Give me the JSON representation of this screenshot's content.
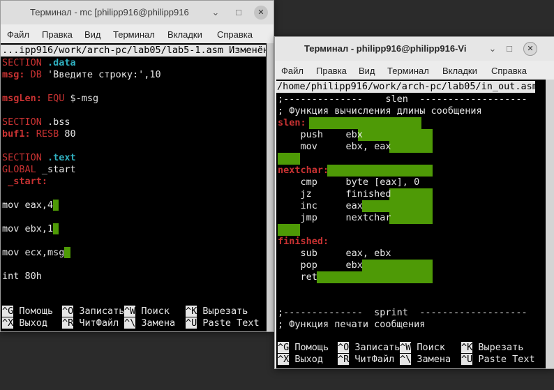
{
  "win1": {
    "title": "Терминал - mc [philipp916@philipp916",
    "minimize": "⌄",
    "maximize": "□",
    "close": "✕",
    "menu": [
      "Файл",
      "Правка",
      "Вид",
      "Терминал",
      "Вкладки",
      "Справка"
    ],
    "header": "...ipp916/work/arch-pc/lab05/lab5-1.asm Изменён",
    "code": {
      "sec_data_kw": "SECTION",
      "sec_data_name": " .data",
      "msg_label": "msg:",
      "msg_db": " DB",
      "msg_str": " 'Введите строку:',10",
      "msglen_label": "msgLen:",
      "msglen_equ": " EQU",
      "msglen_val": " $-msg",
      "sec_bss_kw": "SECTION",
      "sec_bss_name": " .bss",
      "buf_label": "buf1:",
      "buf_resb": " RESB",
      "buf_val": " 80",
      "sec_text_kw": "SECTION",
      "sec_text_name": " .text",
      "global_kw": "GLOBAL",
      "global_val": " _start",
      "start_label": " _start:",
      "l_mov_eax": "mov eax,4",
      "l_mov_ebx": "mov ebx,1",
      "l_mov_ecx": "mov ecx,msg",
      "l_int": "int 80h"
    },
    "shortcuts": {
      "k1": "^G",
      "l1": " Помощь",
      "k2": "^O",
      "l2": " Записать",
      "k3": "^W",
      "l3": " Поиск",
      "k4": "^K",
      "l4": " Вырезать",
      "k5": "^X",
      "l5": " Выход",
      "k6": "^R",
      "l6": " ЧитФайл",
      "k7": "^\\",
      "l7": " Замена",
      "k8": "^U",
      "l8": " Paste Text"
    }
  },
  "win2": {
    "title": "Терминал - philipp916@philipp916-Vi",
    "minimize": "⌄",
    "maximize": "□",
    "close": "✕",
    "menu": [
      "Файл",
      "Правка",
      "Вид",
      "Терминал",
      "Вкладки",
      "Справка"
    ],
    "header": "/home/philipp916/work/arch-pc/lab05/in_out.asm",
    "code": {
      "sep1": ";--------------    slen  -------------------",
      "c1": "; Функция вычисления длины сообщения",
      "slen_label": "slen:",
      "push": "    push    ebx",
      "mov": "    mov     ebx, eax",
      "nextchar_label": "nextchar:",
      "cmp": "    cmp     byte [eax], 0",
      "jz": "    jz      finished",
      "inc": "    inc     eax",
      "jmp": "    jmp     nextchar",
      "finished_label": "finished:",
      "sub": "    sub     eax, ebx",
      "pop": "    pop     ebx",
      "ret": "    ret",
      "sep2": ";--------------  sprint  -------------------",
      "c2": "; Функция печати сообщения"
    },
    "shortcuts": {
      "k1": "^G",
      "l1": " Помощь",
      "k2": "^O",
      "l2": " Записать",
      "k3": "^W",
      "l3": " Поиск",
      "k4": "^K",
      "l4": " Вырезать",
      "k5": "^X",
      "l5": " Выход",
      "k6": "^R",
      "l6": " ЧитФайл",
      "k7": "^\\",
      "l7": " Замена",
      "k8": "^U",
      "l8": " Paste Text"
    }
  },
  "colors": {
    "keyword": "#c83232",
    "string": "#d8d83a",
    "section_name": "#30b0c0",
    "trailing_whitespace": "#4e9a06"
  }
}
